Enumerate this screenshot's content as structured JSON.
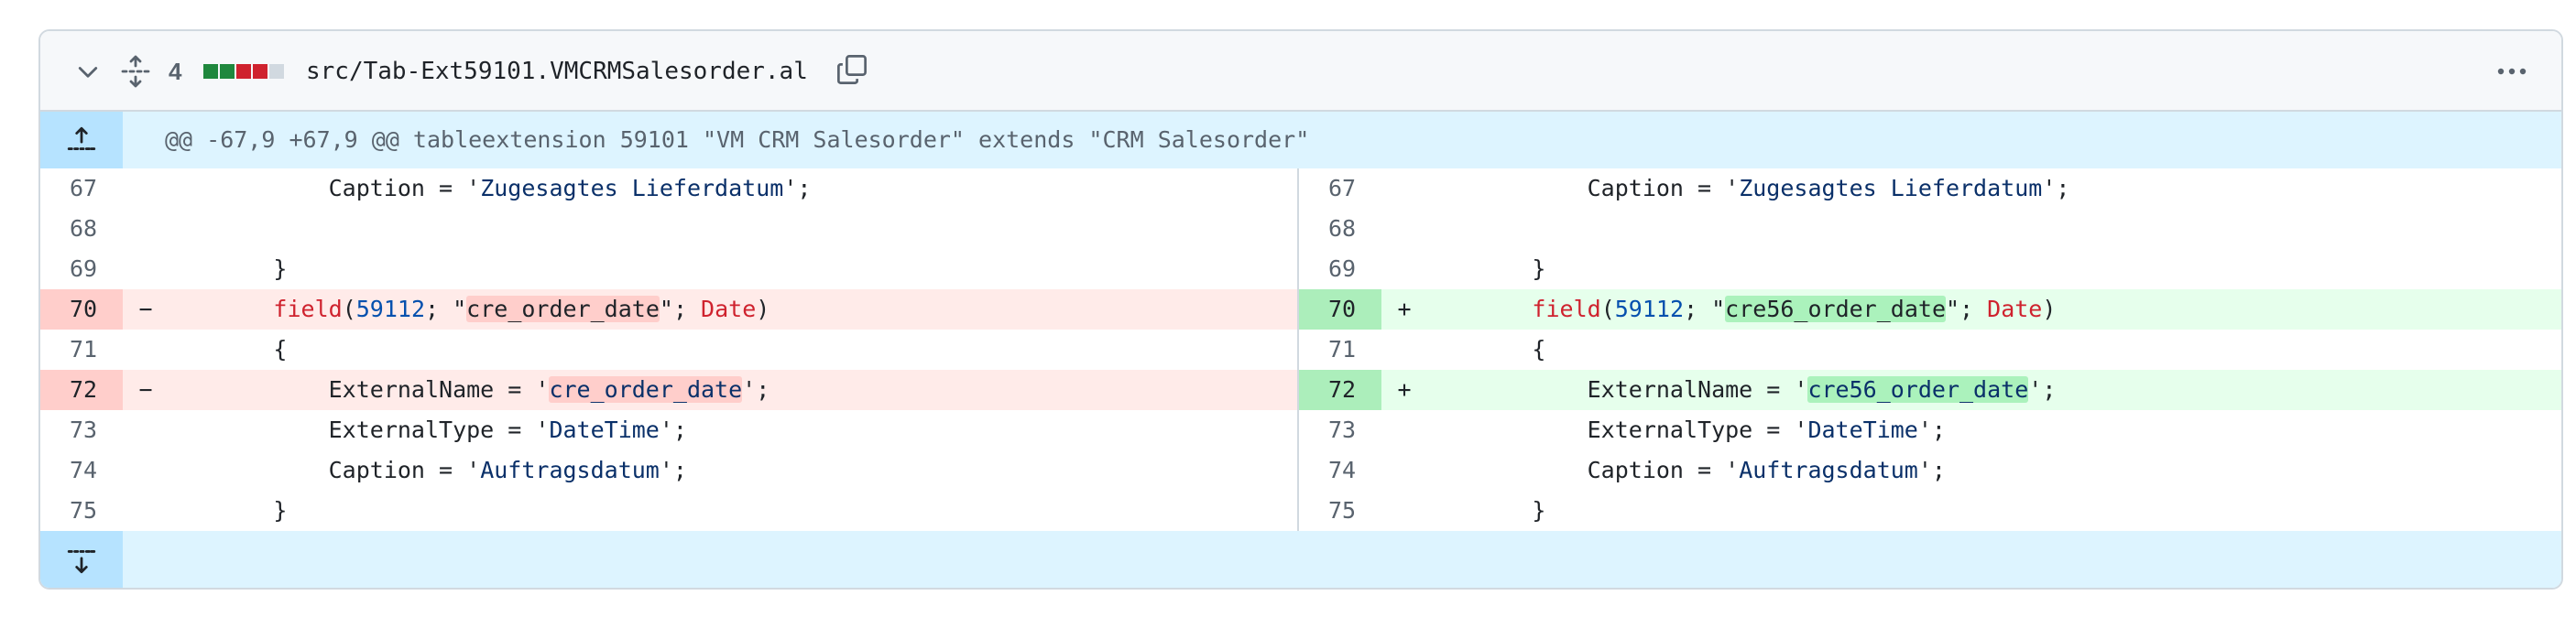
{
  "file": {
    "diff_count": "4",
    "path": "src/Tab-Ext59101.VMCRMSalesorder.al",
    "diffstat_colors": [
      "#1f883d",
      "#1f883d",
      "#cf222e",
      "#cf222e",
      "#d1d9e0"
    ]
  },
  "icons": {
    "collapse": "chevron-down-icon",
    "expand_all": "unfold-icon",
    "copy": "copy-icon",
    "more": "kebab-horizontal-icon",
    "expand_up": "fold-up-icon",
    "expand_down": "fold-down-icon"
  },
  "hunk": {
    "header": "@@ -67,9 +67,9 @@ tableextension 59101 \"VM CRM Salesorder\" extends \"CRM Salesorder\""
  },
  "rows": [
    {
      "left": {
        "num": "67",
        "sign": "",
        "type": "ctx",
        "code": "            Caption = 'Zugesagtes Lieferdatum';"
      },
      "right": {
        "num": "67",
        "sign": "",
        "type": "ctx",
        "code": "            Caption = 'Zugesagtes Lieferdatum';"
      }
    },
    {
      "left": {
        "num": "68",
        "sign": "",
        "type": "ctx",
        "code": ""
      },
      "right": {
        "num": "68",
        "sign": "",
        "type": "ctx",
        "code": ""
      }
    },
    {
      "left": {
        "num": "69",
        "sign": "",
        "type": "ctx",
        "code": "        }"
      },
      "right": {
        "num": "69",
        "sign": "",
        "type": "ctx",
        "code": "        }"
      }
    },
    {
      "left": {
        "num": "70",
        "sign": "−",
        "type": "del",
        "code": "        field(59112; \"cre_order_date\"; Date)"
      },
      "right": {
        "num": "70",
        "sign": "+",
        "type": "add",
        "code": "        field(59112; \"cre56_order_date\"; Date)"
      }
    },
    {
      "left": {
        "num": "71",
        "sign": "",
        "type": "ctx",
        "code": "        {"
      },
      "right": {
        "num": "71",
        "sign": "",
        "type": "ctx",
        "code": "        {"
      }
    },
    {
      "left": {
        "num": "72",
        "sign": "−",
        "type": "del",
        "code": "            ExternalName = 'cre_order_date';"
      },
      "right": {
        "num": "72",
        "sign": "+",
        "type": "add",
        "code": "            ExternalName = 'cre56_order_date';"
      }
    },
    {
      "left": {
        "num": "73",
        "sign": "",
        "type": "ctx",
        "code": "            ExternalType = 'DateTime';"
      },
      "right": {
        "num": "73",
        "sign": "",
        "type": "ctx",
        "code": "            ExternalType = 'DateTime';"
      }
    },
    {
      "left": {
        "num": "74",
        "sign": "",
        "type": "ctx",
        "code": "            Caption = 'Auftragsdatum';"
      },
      "right": {
        "num": "74",
        "sign": "",
        "type": "ctx",
        "code": "            Caption = 'Auftragsdatum';"
      }
    },
    {
      "left": {
        "num": "75",
        "sign": "",
        "type": "ctx",
        "code": "        }"
      },
      "right": {
        "num": "75",
        "sign": "",
        "type": "ctx",
        "code": "        }"
      }
    }
  ],
  "highlights": {
    "del": [
      "cre_order_date"
    ],
    "add": [
      "cre56_order_date"
    ]
  },
  "colors": {
    "keyword": "#cf222e",
    "number": "#0550ae",
    "string": "#0a3069",
    "del_bg": "#ffebe9",
    "add_bg": "#e6ffec",
    "hunk_bg": "#ddf4ff"
  }
}
